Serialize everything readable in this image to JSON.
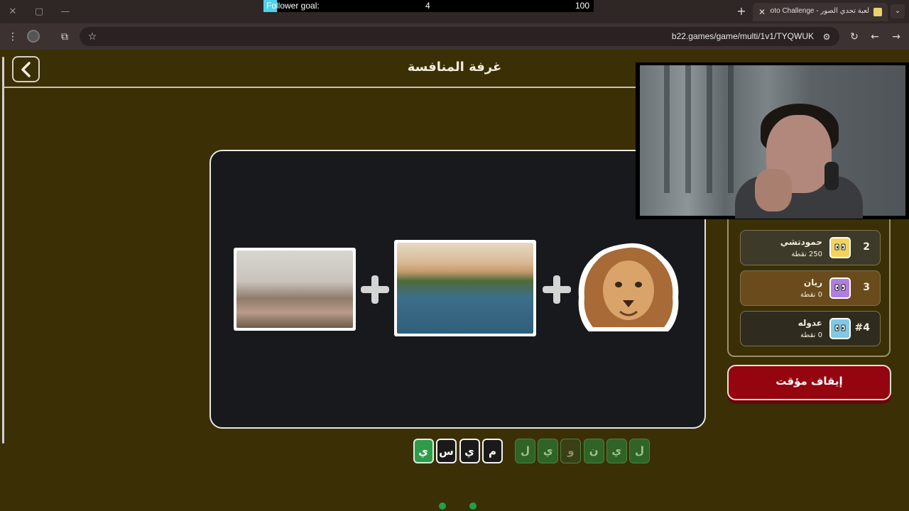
{
  "browser": {
    "window_controls": {
      "close": "✕",
      "restore": "▢",
      "minimize": "—"
    },
    "follower_goal": {
      "label": "Follower goal:",
      "current": "4",
      "target": "100",
      "progress": 0.04
    },
    "new_tab": "+",
    "tab": {
      "close": "✕",
      "title": "لعبة تحدي الصور - Photo Challenge"
    },
    "tab_menu": "⌄",
    "address": "b22.games/game/multi/1v1/TYQWUK",
    "icons": {
      "menu": "⋮",
      "extensions": "⧉",
      "star": "☆",
      "tune": "⚙",
      "reload": "↻",
      "back": "←",
      "forward": "→"
    }
  },
  "page": {
    "room_title": "غرفة المنافسة",
    "puzzle": {
      "images": [
        "messy-office-photo",
        "river-nile-photo",
        "lion-photo"
      ],
      "plus_count": 2
    },
    "answer_letters": [
      "م",
      "ي",
      "س",
      "ي"
    ],
    "answer_correct": [
      false,
      false,
      false,
      true
    ],
    "pick_letters": [
      "ل",
      "ي",
      "و",
      "ن",
      "ي",
      "ل"
    ],
    "pick_used": [
      false,
      false,
      true,
      false,
      false,
      false
    ],
    "pagination": {
      "total": 2,
      "active": 0
    },
    "leaderboard": [
      {
        "rank": "2",
        "name": "حمودتشي",
        "points": "250 نقطة",
        "avatar_color": "#f2d45a",
        "row_bg": "#3d3a2a"
      },
      {
        "rank": "3",
        "name": "ريان",
        "points": "0 نقطة",
        "avatar_color": "#b07de0",
        "row_bg": "#6a4b1c"
      },
      {
        "rank": "#4",
        "name": "عدوله",
        "points": "0 نقطة",
        "avatar_color": "#7ec9e6",
        "row_bg": "#2f2b1e"
      }
    ],
    "stop_timer_label": "إيقاف مؤقت"
  },
  "colors": {
    "page_bg": "#3b2f06",
    "card_bg": "#17191c",
    "correct_green": "#2f9b4a",
    "stop_red": "#94050f",
    "goal_fill": "#4fd1e8"
  }
}
